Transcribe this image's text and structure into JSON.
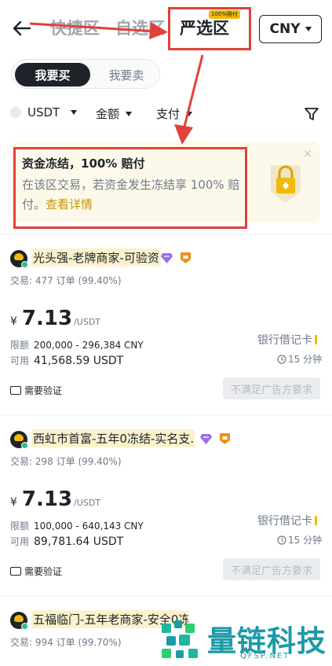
{
  "header": {
    "tabs": [
      {
        "label": "快捷区",
        "active": false
      },
      {
        "label": "自选区",
        "active": false
      },
      {
        "label": "严选区",
        "active": true
      }
    ],
    "active_badge": "100%赔付",
    "currency": "CNY"
  },
  "trade_toggle": {
    "buy_label": "我要买",
    "sell_label": "我要卖",
    "selected": "buy"
  },
  "filters": {
    "coin": "USDT",
    "amount": "金额",
    "payment": "支付"
  },
  "banner": {
    "title": "资金冻结，100% 赔付",
    "desc": "在该区交易，若资金发生冻结享 100% 赔付。",
    "link": "查看详情",
    "close": "×"
  },
  "listings": [
    {
      "merchant": "光头强-老牌商家-可验资",
      "stats": "交易: 477 订单 (99.40%)",
      "currency_symbol": "¥",
      "price": "7.13",
      "unit": "/USDT",
      "limit_label": "限额",
      "limit": "200,000 - 296,384 CNY",
      "avail_label": "可用",
      "available": "41,568.59 USDT",
      "payment": "银行借记卡",
      "time": "15 分钟",
      "verify": "需要验证",
      "action": "不满足广告方要求"
    },
    {
      "merchant": "西虹市首富-五年0冻结-实名支...",
      "stats": "交易: 298 订单 (99.40%)",
      "currency_symbol": "¥",
      "price": "7.13",
      "unit": "/USDT",
      "limit_label": "限额",
      "limit": "100,000 - 640,143 CNY",
      "avail_label": "可用",
      "available": "89,781.64 USDT",
      "payment": "银行借记卡",
      "time": "15 分钟",
      "verify": "需要验证",
      "action": "不满足广告方要求"
    },
    {
      "merchant": "五福临门-五年老商家-安全0冻",
      "stats": "交易: 994 订单 (99.70%)"
    }
  ],
  "watermark": {
    "title": "量链科技",
    "sub": "QFSP.NET"
  },
  "colors": {
    "accent": "#f0b90b",
    "annotation": "#e0413a",
    "watermark": "#1d9aa8"
  }
}
